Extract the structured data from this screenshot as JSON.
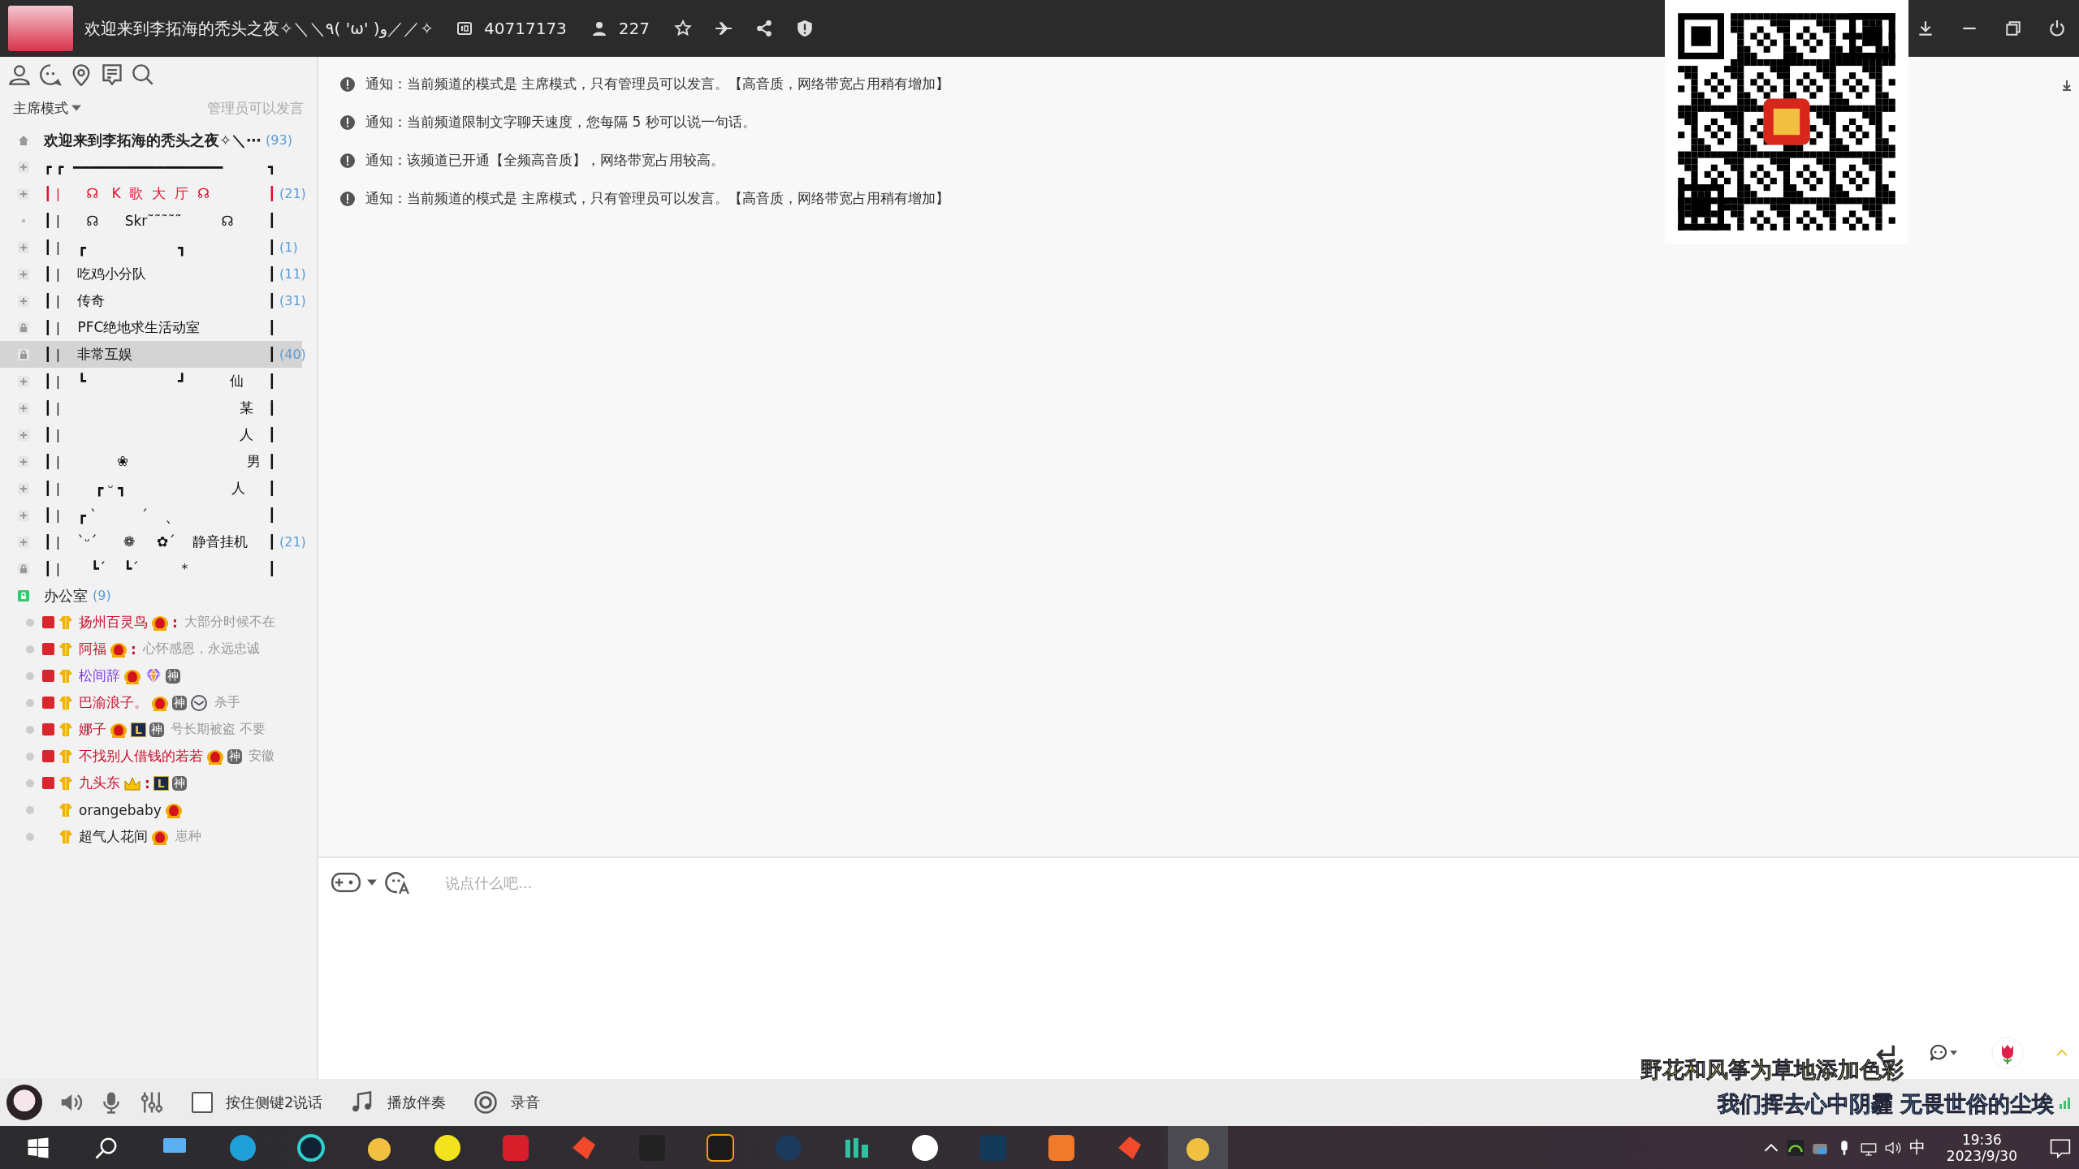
{
  "title_bar": {
    "title": "欢迎来到李拓海的秃头之夜✧＼＼٩( 'ω' )و／／✧",
    "channel_id": "40717173",
    "online_count": "227"
  },
  "sidebar": {
    "mode": "主席模式",
    "mode_note": "管理员可以发言",
    "root": {
      "name": "欢迎来到李拓海的秃头之夜✧＼⋯",
      "count": "(93)"
    },
    "channels": [
      {
        "kind": "plus",
        "frame_left": "┏ ┏",
        "text": "━━━━━━━━━━━━━━━━━━",
        "frame_right": "┓",
        "color": "#111111",
        "selected": false
      },
      {
        "kind": "plus",
        "frame_left": "┃ |",
        "text": "   ☊   K  歌  大  厅  ☊",
        "frame_right": "┃",
        "count": "(21)",
        "color": "#e0102a",
        "selected": false
      },
      {
        "kind": "dot",
        "frame_left": "┃ |",
        "text": "   ☊      Skr˜˜˜˜˜         ☊",
        "frame_right": "┃",
        "color": "#111111",
        "selected": false
      },
      {
        "kind": "plus",
        "frame_left": "┃ |",
        "text": " ┏                     ┓",
        "frame_right": "┃",
        "count": "(1)",
        "color": "#111111",
        "selected": false
      },
      {
        "kind": "plus",
        "frame_left": "┃ |",
        "text": " 吃鸡小分队",
        "frame_right": "┃",
        "count": "(11)",
        "color": "#111111",
        "selected": false
      },
      {
        "kind": "plus",
        "frame_left": "┃ |",
        "text": " 传奇",
        "frame_right": "┃",
        "count": "(31)",
        "color": "#111111",
        "selected": false
      },
      {
        "kind": "lock",
        "frame_left": "┃ |",
        "text": " PFC绝地求生活动室",
        "frame_right": "┃",
        "color": "#111111",
        "selected": false
      },
      {
        "kind": "lock",
        "frame_left": "┃ |",
        "text": " 非常互娱",
        "frame_right": "┃",
        "count": "(40)",
        "color": "#111111",
        "selected": true
      },
      {
        "kind": "plus",
        "frame_left": "┃ |",
        "text": " ┗                     ┛          仙",
        "frame_right": "┃",
        "color": "#111111",
        "selected": false
      },
      {
        "kind": "plus",
        "frame_left": "┃ |",
        "text": "                                      某",
        "frame_right": "┃",
        "color": "#111111",
        "selected": false
      },
      {
        "kind": "plus",
        "frame_left": "┃ |",
        "text": "                                      人",
        "frame_right": "┃",
        "color": "#111111",
        "selected": false
      },
      {
        "kind": "plus",
        "frame_left": "┃ |",
        "text": "          ❀                           男",
        "frame_right": "┃",
        "color": "#111111",
        "selected": false
      },
      {
        "kind": "plus",
        "frame_left": "┃ |",
        "text": "     ┏ ᵕ ┓                        人",
        "frame_right": "┃",
        "color": "#111111",
        "selected": false
      },
      {
        "kind": "plus",
        "frame_left": "┃ |",
        "text": " ┏ ˋ          ˊ    ˎ",
        "frame_right": "┃",
        "color": "#111111",
        "selected": false
      },
      {
        "kind": "plus",
        "frame_left": "┃ |",
        "text": " ˋᵕˊ      ❁     ✿ˊ    静音挂机",
        "frame_right": "┃",
        "count": "(21)",
        "color": "#111111",
        "selected": false
      },
      {
        "kind": "lock",
        "frame_left": "┃ |",
        "text": "    ┗ˊ    ┗ˊ         ＊",
        "frame_right": "┃",
        "color": "#111111",
        "selected": false
      }
    ],
    "office": {
      "name": "办公室",
      "count": "(9)"
    },
    "users": [
      {
        "vip": true,
        "name": "扬州百灵鸟",
        "color": "#c8102e",
        "badges": [
          {
            "kind": "crown"
          },
          {
            "kind": "colon",
            "label": ":"
          }
        ],
        "signature": "大部分时候不在"
      },
      {
        "vip": true,
        "name": "阿福",
        "color": "#c8102e",
        "badges": [
          {
            "kind": "crown"
          },
          {
            "kind": "colon",
            "label": ":"
          }
        ],
        "signature": "心怀感恩，永远忠诚"
      },
      {
        "vip": true,
        "name": "松间辞",
        "color": "#7a3ce0",
        "badges": [
          {
            "kind": "crown"
          },
          {
            "kind": "gem"
          },
          {
            "kind": "seal",
            "label": "神"
          }
        ]
      },
      {
        "vip": true,
        "name": "巴渝浪子。",
        "color": "#c8102e",
        "badges": [
          {
            "kind": "crown"
          },
          {
            "kind": "seal",
            "label": "神"
          },
          {
            "kind": "clock"
          }
        ],
        "signature": "杀手"
      },
      {
        "vip": true,
        "name": "娜子",
        "color": "#c8102e",
        "badges": [
          {
            "kind": "crown"
          },
          {
            "kind": "letter",
            "label": "L"
          },
          {
            "kind": "seal",
            "label": "神"
          }
        ],
        "signature": "号长期被盗 不要"
      },
      {
        "vip": true,
        "name": "不找别人借钱的若若",
        "color": "#c8102e",
        "badges": [
          {
            "kind": "crown"
          },
          {
            "kind": "seal",
            "label": "神"
          }
        ],
        "signature": "安徽"
      },
      {
        "vip": true,
        "name": "九头东",
        "color": "#c8102e",
        "badges": [
          {
            "kind": "small-crown"
          },
          {
            "kind": "colon",
            "label": ":"
          },
          {
            "kind": "letter",
            "label": "L"
          },
          {
            "kind": "seal",
            "label": "神"
          }
        ]
      },
      {
        "vip": false,
        "name": "orangebaby",
        "color": "#222222",
        "badges": [
          {
            "kind": "crown"
          }
        ]
      },
      {
        "vip": false,
        "name": "超气人花间",
        "color": "#222222",
        "badges": [
          {
            "kind": "crown"
          }
        ],
        "signature": "崽种"
      }
    ]
  },
  "notices": [
    {
      "label": "通知：",
      "text": "当前频道的模式是 主席模式，只有管理员可以发言。【高音质，网络带宽占用稍有增加】"
    },
    {
      "label": "通知：",
      "text": "当前频道限制文字聊天速度，您每隔 5 秒可以说一句话。"
    },
    {
      "label": "通知：",
      "text": "该频道已开通【全频高音质】，网络带宽占用较高。"
    },
    {
      "label": "通知：",
      "text": "当前频道的模式是 主席模式，只有管理员可以发言。【高音质，网络带宽占用稍有增加】"
    }
  ],
  "chat_input": {
    "placeholder": "说点什么吧..."
  },
  "bottom_bar": {
    "push_to_talk": {
      "label": "按住侧键2说话",
      "checked": false
    },
    "accompaniment": "播放伴奏",
    "record": "录音"
  },
  "lyrics": [
    "野花和风筝为草地添加色彩",
    "我们挥去心中阴霾 无畏世俗的尘埃"
  ],
  "taskbar": {
    "ime": "中",
    "time": "19:36",
    "date": "2023/9/30"
  }
}
